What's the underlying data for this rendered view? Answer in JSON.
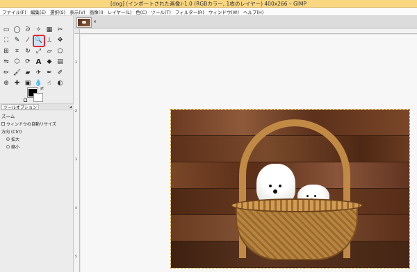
{
  "window": {
    "title": "[dog] (インポートされた画像)-1.0 (RGBカラー, 1枚のレイヤー) 400x266 – GIMP",
    "accent_color": "#f9d680"
  },
  "menubar": {
    "items": [
      "ファイル(F)",
      "編集(E)",
      "選択(S)",
      "表示(V)",
      "画像(I)",
      "レイヤー(L)",
      "色(C)",
      "ツール(T)",
      "フィルター(R)",
      "ウィンドウ(W)",
      "ヘルプ(H)"
    ]
  },
  "toolbox": {
    "tools": [
      {
        "name": "rect-select-icon",
        "glyph": "▭"
      },
      {
        "name": "ellipse-select-icon",
        "glyph": "◯"
      },
      {
        "name": "free-select-icon",
        "glyph": "ᘐ"
      },
      {
        "name": "fuzzy-select-icon",
        "glyph": "✧"
      },
      {
        "name": "color-select-icon",
        "glyph": "▦"
      },
      {
        "name": "scissors-select-icon",
        "glyph": "✂"
      },
      {
        "name": "foreground-select-icon",
        "glyph": "⛶"
      },
      {
        "name": "paths-icon",
        "glyph": "✎"
      },
      {
        "name": "color-picker-icon",
        "glyph": "⁄"
      },
      {
        "name": "zoom-icon",
        "glyph": "🔍",
        "selected": true
      },
      {
        "name": "measure-icon",
        "glyph": "⟂"
      },
      {
        "name": "move-icon",
        "glyph": "✥"
      },
      {
        "name": "align-icon",
        "glyph": "⊞"
      },
      {
        "name": "crop-icon",
        "glyph": "⌗"
      },
      {
        "name": "rotate-icon",
        "glyph": "↻"
      },
      {
        "name": "scale-icon",
        "glyph": "⤢"
      },
      {
        "name": "shear-icon",
        "glyph": "▱"
      },
      {
        "name": "perspective-icon",
        "glyph": "⬠"
      },
      {
        "name": "flip-icon",
        "glyph": "⇋"
      },
      {
        "name": "cage-icon",
        "glyph": "⬡"
      },
      {
        "name": "warp-icon",
        "glyph": "⟳"
      },
      {
        "name": "text-icon",
        "glyph": "A",
        "bold": true
      },
      {
        "name": "bucket-fill-icon",
        "glyph": "◆"
      },
      {
        "name": "blend-icon",
        "glyph": "▤"
      },
      {
        "name": "pencil-icon",
        "glyph": "✏"
      },
      {
        "name": "paintbrush-icon",
        "glyph": "🖌"
      },
      {
        "name": "eraser-icon",
        "glyph": "▰"
      },
      {
        "name": "airbrush-icon",
        "glyph": "✈"
      },
      {
        "name": "ink-icon",
        "glyph": "✒"
      },
      {
        "name": "mypaint-brush-icon",
        "glyph": "✐"
      },
      {
        "name": "clone-icon",
        "glyph": "⊕"
      },
      {
        "name": "heal-icon",
        "glyph": "✚"
      },
      {
        "name": "perspective-clone-icon",
        "glyph": "▣"
      },
      {
        "name": "blur-icon",
        "glyph": "💧"
      },
      {
        "name": "smudge-icon",
        "glyph": "☝"
      },
      {
        "name": "dodge-burn-icon",
        "glyph": "◐"
      }
    ]
  },
  "colors": {
    "foreground": "#000000",
    "background": "#ffffff"
  },
  "tool_options": {
    "tab_label": "ツールオプション",
    "tool_name": "ズーム",
    "resize_window_label": "ウィンドウの自動リサイズ",
    "direction_label": "方向 (Ctrl)",
    "zoom_in_label": "拡大",
    "zoom_out_label": "縮小",
    "selected_direction": "拡大"
  },
  "ruler_left_numbers": [
    "1",
    "2",
    "3",
    "4",
    "5"
  ],
  "image": {
    "width": 400,
    "height": 266
  }
}
